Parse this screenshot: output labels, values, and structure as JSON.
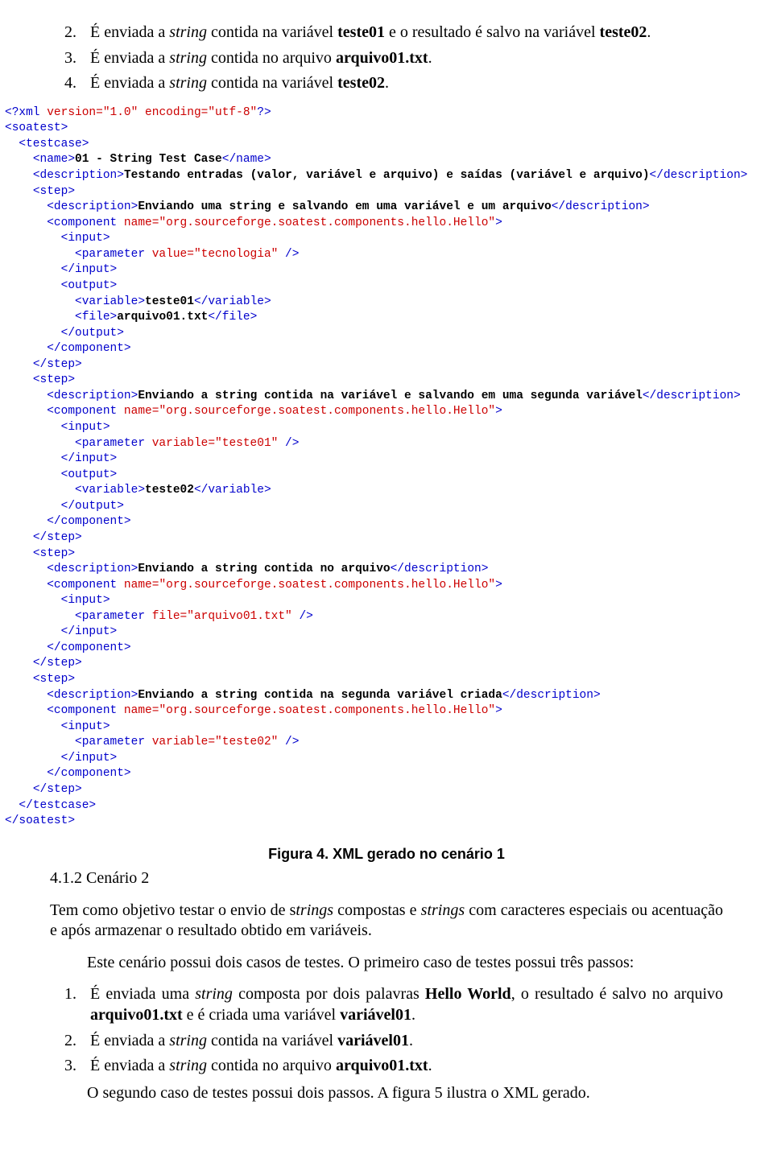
{
  "doc": {
    "topList": [
      {
        "num": "2.",
        "pre": "É enviada a ",
        "it1": "string",
        "mid1": " contida na variável ",
        "b1": "teste01",
        "mid2": " e o resultado é salvo na variável ",
        "b2": "teste02",
        "post": "."
      },
      {
        "num": "3.",
        "pre": "É enviada a ",
        "it1": "string",
        "mid1": " contida no arquivo ",
        "b1": "arquivo01.txt",
        "post": "."
      },
      {
        "num": "4.",
        "pre": "É enviada a ",
        "it1": "string",
        "mid1": " contida na variável ",
        "b1": "teste02",
        "post": "."
      }
    ],
    "caption": "Figura 4. XML gerado no cenário 1",
    "section": "4.1.2 Cenário 2",
    "para1_a": "Tem como objetivo testar o envio de s",
    "para1_it1": "trings",
    "para1_b": " compostas e ",
    "para1_it2": "strings",
    "para1_c": " com caracteres especiais ou acentuação e após armazenar o resultado obtido em variáveis.",
    "para2": "Este cenário possui dois casos de testes. O primeiro caso de testes possui três passos:",
    "steps": [
      {
        "num": "1.",
        "pre": "É enviada uma ",
        "it1": "string",
        "mid1": " composta por dois palavras ",
        "b1": "Hello World",
        "mid2": ", o resultado é salvo no arquivo ",
        "b2": "arquivo01.txt",
        "mid3": " e é criada uma variável ",
        "b3": "variável01",
        "post": "."
      },
      {
        "num": "2.",
        "pre": "É enviada a ",
        "it1": "string",
        "mid1": " contida na variável ",
        "b1": "variável01",
        "post": "."
      },
      {
        "num": "3.",
        "pre": "É enviada a ",
        "it1": "string",
        "mid1": " contida no arquivo ",
        "b1": "arquivo01.txt",
        "post": "."
      }
    ],
    "para3": "O segundo caso de testes possui dois passos. A figura 5 ilustra o XML gerado."
  },
  "xml": {
    "line01": {
      "open": "<?xml",
      "attrs": " version=\"1.0\" encoding=\"utf-8\"",
      "close": "?>"
    },
    "line02": "<soatest>",
    "line03": "<testcase>",
    "line04": {
      "open": "<name>",
      "text": "01 - String Test Case",
      "close": "</name>"
    },
    "line05": {
      "open": "<description>",
      "text": "Testando entradas (valor, variável e arquivo) e saídas (variável e arquivo)",
      "close": "</description>"
    },
    "line06": "<step>",
    "line07": {
      "open": "<description>",
      "text": "Enviando uma string e salvando em uma variável e um arquivo",
      "close": "</description>"
    },
    "line08": {
      "open": "<component",
      "attrs": " name=\"org.sourceforge.soatest.components.hello.Hello\"",
      "close": ">"
    },
    "line09": "<input>",
    "line10": {
      "open": "<parameter",
      "attrs": " value=\"tecnologia\"",
      "close": " />"
    },
    "line11": "</input>",
    "line12": "<output>",
    "line13": {
      "open": "<variable>",
      "text": "teste01",
      "close": "</variable>"
    },
    "line14": {
      "open": "<file>",
      "text": "arquivo01.txt",
      "close": "</file>"
    },
    "line15": "</output>",
    "line16": "</component>",
    "line17": "</step>",
    "line18": "<step>",
    "line19": {
      "open": "<description>",
      "text": "Enviando a string contida na variável e salvando em uma segunda variável",
      "close": "</description>"
    },
    "line20": {
      "open": "<component",
      "attrs": " name=\"org.sourceforge.soatest.components.hello.Hello\"",
      "close": ">"
    },
    "line21": "<input>",
    "line22": {
      "open": "<parameter",
      "attrs": " variable=\"teste01\"",
      "close": " />"
    },
    "line23": "</input>",
    "line24": "<output>",
    "line25": {
      "open": "<variable>",
      "text": "teste02",
      "close": "</variable>"
    },
    "line26": "</output>",
    "line27": "</component>",
    "line28": "</step>",
    "line29": "<step>",
    "line30": {
      "open": "<description>",
      "text": "Enviando a string contida no arquivo",
      "close": "</description>"
    },
    "line31": {
      "open": "<component",
      "attrs": " name=\"org.sourceforge.soatest.components.hello.Hello\"",
      "close": ">"
    },
    "line32": "<input>",
    "line33": {
      "open": "<parameter",
      "attrs": " file=\"arquivo01.txt\"",
      "close": " />"
    },
    "line34": "</input>",
    "line35": "</component>",
    "line36": "</step>",
    "line37": "<step>",
    "line38": {
      "open": "<description>",
      "text": "Enviando a string contida na segunda variável criada",
      "close": "</description>"
    },
    "line39": {
      "open": "<component",
      "attrs": " name=\"org.sourceforge.soatest.components.hello.Hello\"",
      "close": ">"
    },
    "line40": "<input>",
    "line41": {
      "open": "<parameter",
      "attrs": " variable=\"teste02\"",
      "close": " />"
    },
    "line42": "</input>",
    "line43": "</component>",
    "line44": "</step>",
    "line45": "</testcase>",
    "line46": "</soatest>"
  }
}
